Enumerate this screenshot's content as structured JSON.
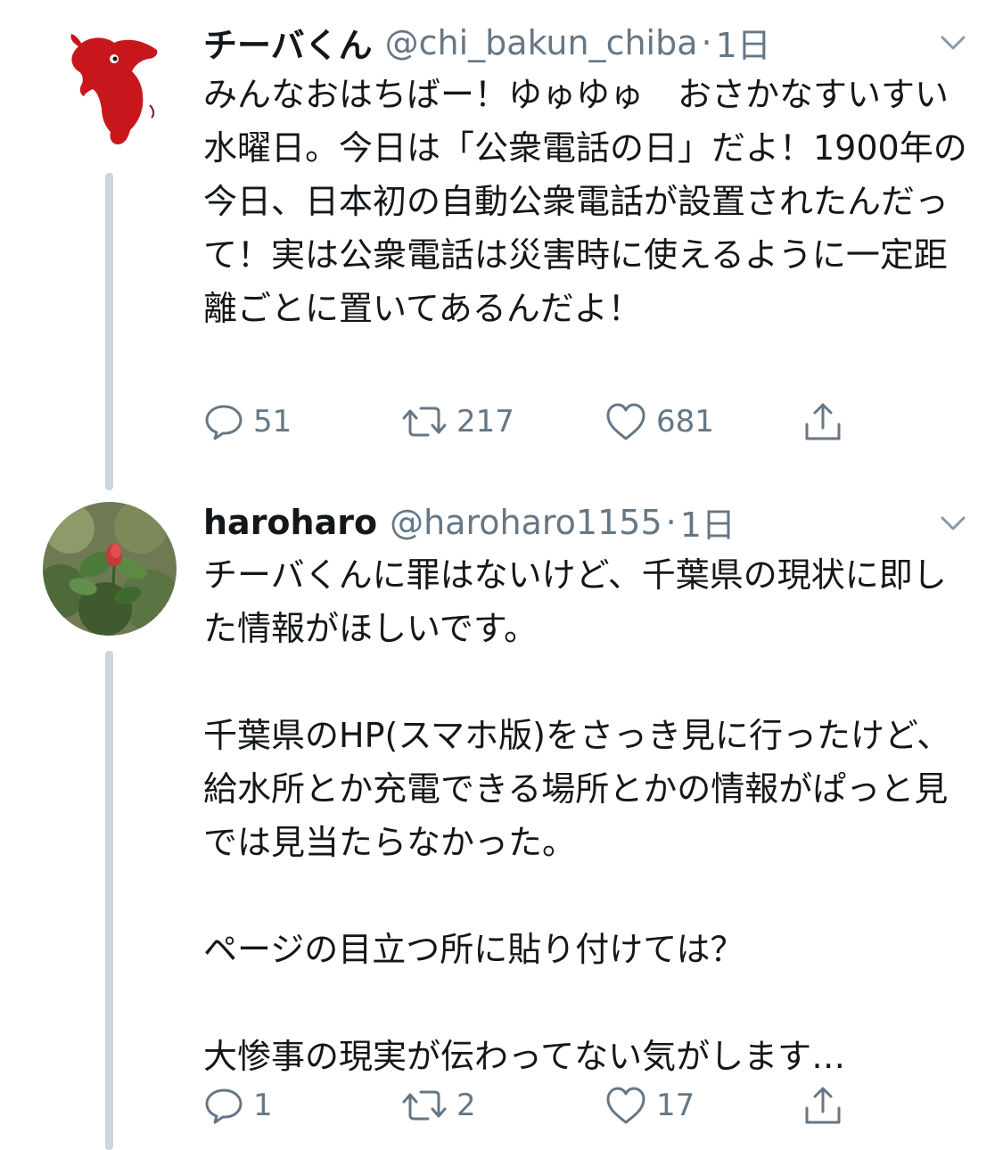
{
  "tweets": [
    {
      "display_name": "チーバくん",
      "handle": "@chi_bakun_chiba",
      "separator": "·",
      "time": "1日",
      "avatar_icon": "red-mascot-avatar",
      "text": "みんなおはちばー！ゆゅゆゅ　おさかなすいすい水曜日。今日は「公衆電話の日」だよ！1900年の今日、日本初の自動公衆電話が設置されたんだって！実は公衆電話は災害時に使えるように一定距離ごとに置いてあるんだよ！",
      "replies": "51",
      "retweets": "217",
      "likes": "681"
    },
    {
      "display_name": "haroharo",
      "handle": "@haroharo1155",
      "separator": "·",
      "time": "1日",
      "avatar_icon": "rose-photo-avatar",
      "text": "チーバくんに罪はないけど、千葉県の現状に即した情報がほしいです。\n\n千葉県のHP(スマホ版)をさっき見に行ったけど、給水所とか充電できる場所とかの情報がぱっと見では見当たらなかった。\n\nページの目立つ所に貼り付けては？\n\n大惨事の現実が伝わってない気がします…",
      "replies": "1",
      "retweets": "2",
      "likes": "17"
    }
  ],
  "colors": {
    "text": "#14171a",
    "secondary": "#657786",
    "thread_line": "#ccd6dd",
    "mascot_red": "#c8161d"
  }
}
